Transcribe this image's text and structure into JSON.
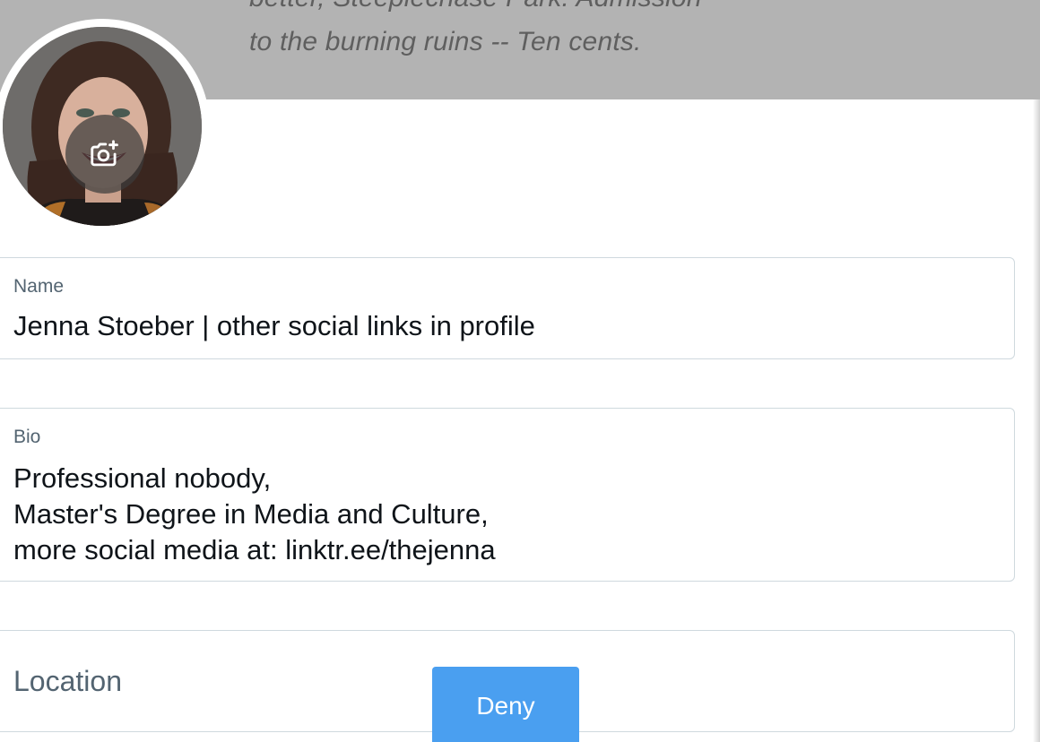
{
  "banner": {
    "line1": "better, Steeplechase Park. Admission",
    "line2": "to the burning ruins -- Ten cents."
  },
  "avatar": {
    "change_photo_icon": "camera-plus-icon"
  },
  "name_field": {
    "label": "Name",
    "value": "Jenna Stoeber | other social links in profile"
  },
  "bio_field": {
    "label": "Bio",
    "lines": [
      "Professional nobody,",
      "Master's Degree in Media and Culture,",
      "more social media at: linktr.ee/thejenna"
    ]
  },
  "location_field": {
    "placeholder": "Location",
    "value": ""
  },
  "actions": {
    "deny_label": "Deny"
  },
  "colors": {
    "accent": "#4a9ff0",
    "border": "#cfd9de",
    "label": "#536471",
    "text": "#0f1419",
    "banner": "#b3b3b3"
  }
}
